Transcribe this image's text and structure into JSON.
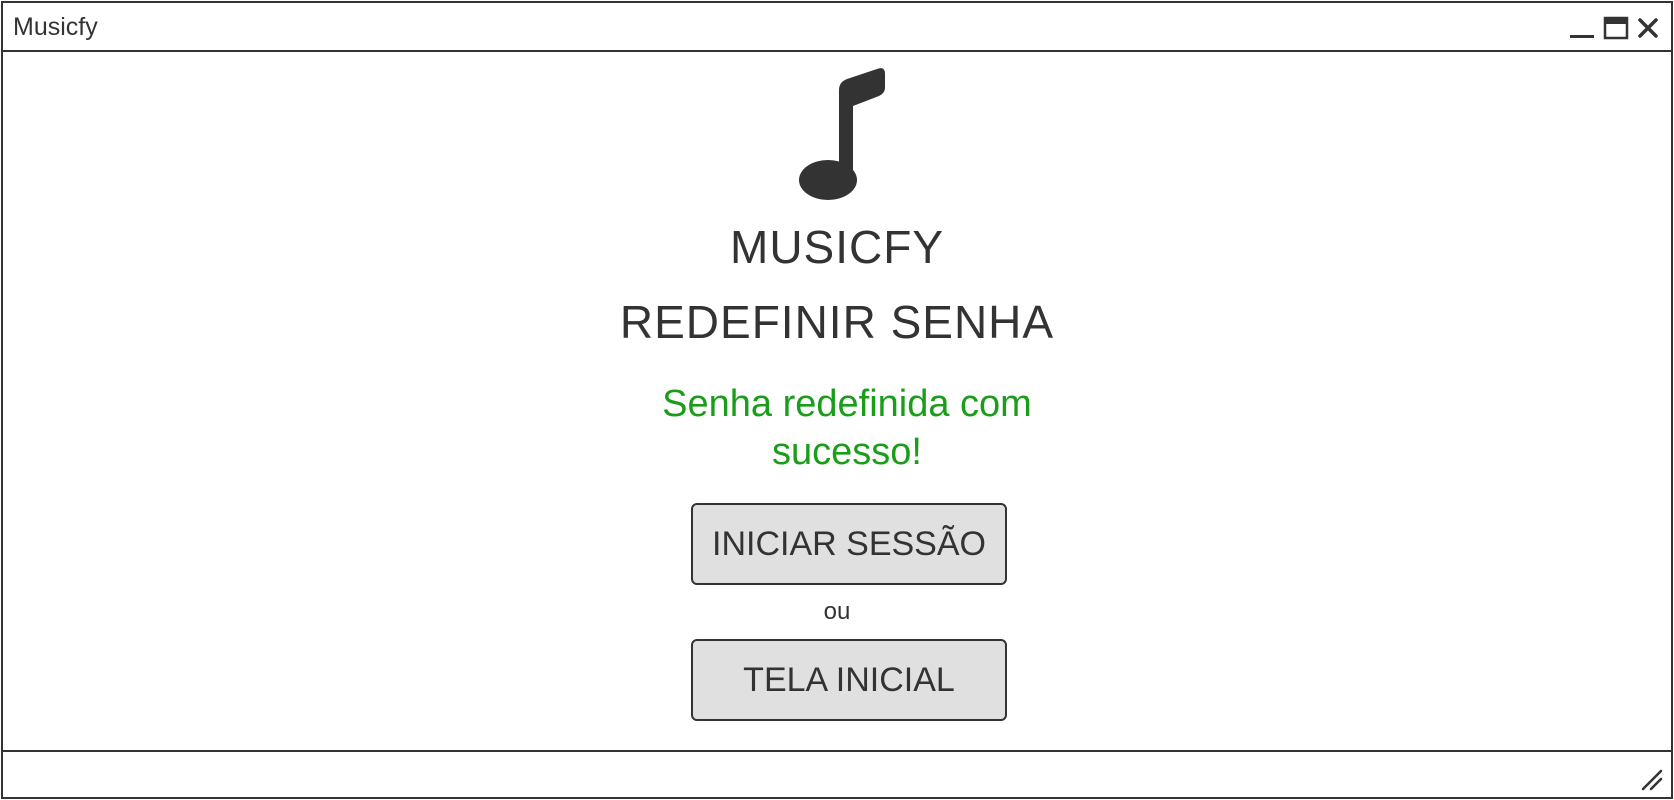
{
  "window": {
    "title": "Musicfy",
    "controls": {
      "minimize": "minimize-icon",
      "maximize": "maximize-icon",
      "close": "close-icon"
    }
  },
  "logo": {
    "icon": "music-note-icon",
    "color": "#333333"
  },
  "brand": {
    "name": "MUSICFY"
  },
  "page": {
    "title": "REDEFINIR SENHA"
  },
  "message": {
    "success": "Senha redefinida com sucesso!",
    "color": "#1a9e1a"
  },
  "actions": {
    "login_label": "INICIAR SESSÃO",
    "separator": "ou",
    "home_label": "TELA INICIAL"
  },
  "statusbar": {
    "resize": "resize-grip-icon"
  }
}
